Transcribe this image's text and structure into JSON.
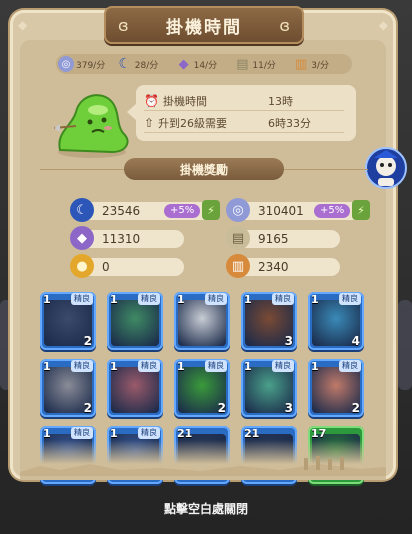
{
  "window": {
    "title": "掛機時間"
  },
  "rates": [
    {
      "icon": "silver-coin-icon",
      "value": "379/分",
      "color": "#8f9ad6"
    },
    {
      "icon": "moon-icon",
      "value": "28/分",
      "color": "#3a64c6"
    },
    {
      "icon": "crystal-icon",
      "value": "14/分",
      "color": "#8c67c8"
    },
    {
      "icon": "scroll-icon",
      "value": "11/分",
      "color": "#c9bd99"
    },
    {
      "icon": "book-scroll-icon",
      "value": "3/分",
      "color": "#d78a3b"
    }
  ],
  "idle": {
    "time_label": "掛機時間",
    "time_value": "13時",
    "upgrade_label": "升到26級需要",
    "upgrade_value": "6時33分"
  },
  "rewards_title": "掛機獎勵",
  "rewards": [
    {
      "icon": "moon-icon",
      "value": "23546",
      "bonus": "+5%"
    },
    {
      "icon": "silver-coin-icon",
      "value": "310401",
      "bonus": "+5%"
    },
    {
      "icon": "crystal-icon",
      "value": "11310"
    },
    {
      "icon": "scroll-icon",
      "value": "9165"
    },
    {
      "icon": "gold-coin-icon",
      "value": "0"
    },
    {
      "icon": "book-scroll-icon",
      "value": "2340"
    }
  ],
  "cards": [
    {
      "level": "1",
      "quality": "精良",
      "stars": "2",
      "portrait": "hooded-warrior",
      "color": "#3b4a6a"
    },
    {
      "level": "1",
      "quality": "精良",
      "stars": "",
      "portrait": "fish-monster",
      "color": "#3f8a64"
    },
    {
      "level": "1",
      "quality": "精良",
      "stars": "",
      "portrait": "white-tiger",
      "color": "#c8ccd4"
    },
    {
      "level": "1",
      "quality": "精良",
      "stars": "3",
      "portrait": "werewolf",
      "color": "#7a4a34"
    },
    {
      "level": "1",
      "quality": "精良",
      "stars": "4",
      "portrait": "blue-dragon",
      "color": "#3a8ab8"
    },
    {
      "level": "1",
      "quality": "精良",
      "stars": "2",
      "portrait": "knight",
      "color": "#8a8c98"
    },
    {
      "level": "1",
      "quality": "精良",
      "stars": "",
      "portrait": "gorilla",
      "color": "#9a5a6a"
    },
    {
      "level": "1",
      "quality": "精良",
      "stars": "2",
      "portrait": "green-plant-monster",
      "color": "#3a9a3a"
    },
    {
      "level": "1",
      "quality": "精良",
      "stars": "3",
      "portrait": "stone-golem",
      "color": "#4aa08a"
    },
    {
      "level": "1",
      "quality": "精良",
      "stars": "2",
      "portrait": "pig",
      "color": "#c07a6a"
    },
    {
      "level": "1",
      "quality": "精良",
      "stars": "",
      "portrait": "partial-1",
      "color": "#3a5a9a"
    },
    {
      "level": "1",
      "quality": "精良",
      "stars": "",
      "portrait": "partial-2",
      "color": "#3a5a9a"
    },
    {
      "level": "21",
      "quality": "",
      "stars": "",
      "portrait": "partial-3",
      "color": "#2a3a5a"
    },
    {
      "level": "21",
      "quality": "",
      "stars": "",
      "portrait": "partial-4",
      "color": "#2a3a5a"
    },
    {
      "level": "17",
      "quality": "",
      "stars": "",
      "portrait": "partial-5",
      "color": "#2a7a3a",
      "green": true
    }
  ],
  "hint": "點擊空白處關閉"
}
